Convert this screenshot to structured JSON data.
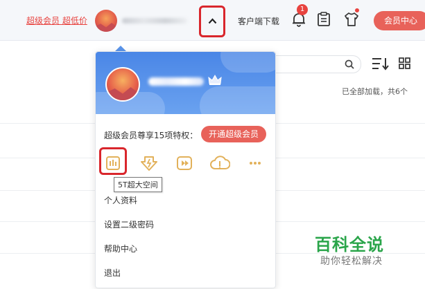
{
  "header": {
    "promo_link": "超级会员 超低价",
    "client_download": "客户端下载",
    "notification_count": "1",
    "vip_center": "会员中心"
  },
  "toolbar": {
    "loaded_status": "已全部加载，共6个"
  },
  "dropdown": {
    "vip_privileges_text": "超级会员尊享15项特权：",
    "open_vip_button": "开通超级会员",
    "privilege_icons": [
      "storage-icon",
      "speed-download-icon",
      "video-icon",
      "cloud-upload-icon",
      "more-icon"
    ],
    "tooltip": "5T超大空间",
    "menu": [
      "个人资料",
      "设置二级密码",
      "帮助中心",
      "退出"
    ]
  },
  "watermark": {
    "title": "百科全说",
    "subtitle": "助你轻松解决"
  },
  "colors": {
    "accent_red": "#e8625a",
    "header_blue": "#4a86e6",
    "icon_gold": "#e2b15a",
    "highlight_red": "#d9262c",
    "watermark_green": "#2aa54a"
  }
}
